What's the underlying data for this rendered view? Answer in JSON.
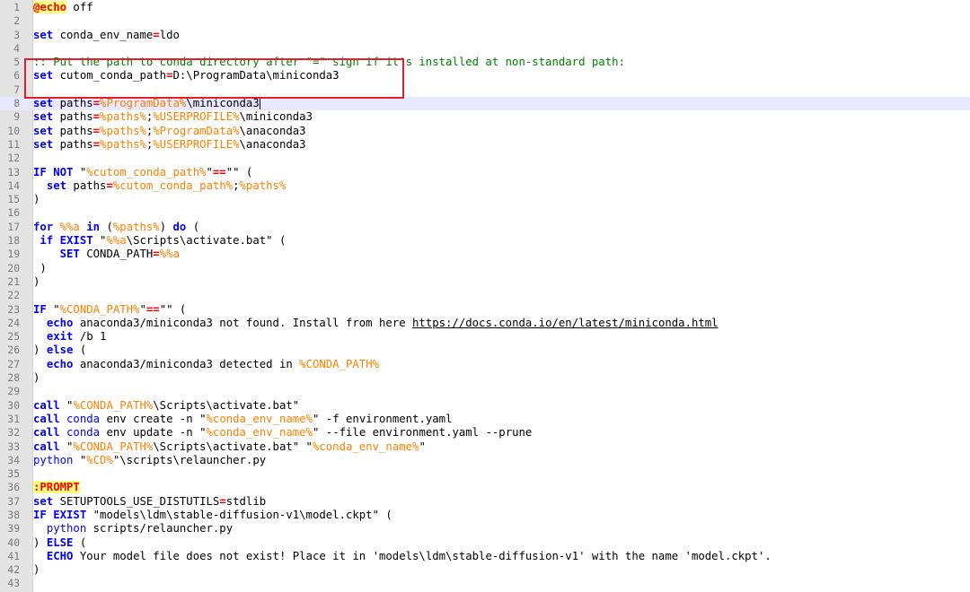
{
  "editor": {
    "lines": [
      {
        "n": "1",
        "tokens": [
          {
            "t": "@echo",
            "c": "lbl"
          },
          {
            "t": " off"
          }
        ]
      },
      {
        "n": "2",
        "tokens": []
      },
      {
        "n": "3",
        "tokens": [
          {
            "t": "set",
            "c": "k"
          },
          {
            "t": " conda_env_name"
          },
          {
            "t": "=",
            "c": "o"
          },
          {
            "t": "ldo"
          }
        ]
      },
      {
        "n": "4",
        "tokens": []
      },
      {
        "n": "5",
        "tokens": [
          {
            "t": ":: Put the path to conda directory after \"=\" sign if it's installed at non-standard path:",
            "c": "c"
          }
        ]
      },
      {
        "n": "6",
        "tokens": [
          {
            "t": "set",
            "c": "k"
          },
          {
            "t": " cutom_conda_path"
          },
          {
            "t": "=",
            "c": "o"
          },
          {
            "t": "D:\\ProgramData\\miniconda3"
          }
        ]
      },
      {
        "n": "7",
        "tokens": []
      },
      {
        "n": "8",
        "cur": true,
        "tokens": [
          {
            "t": "set",
            "c": "k"
          },
          {
            "t": " paths"
          },
          {
            "t": "=",
            "c": "o"
          },
          {
            "t": "%ProgramData%",
            "c": "v"
          },
          {
            "t": "\\miniconda3"
          },
          {
            "caret": true
          }
        ]
      },
      {
        "n": "9",
        "tokens": [
          {
            "t": "set",
            "c": "k"
          },
          {
            "t": " paths"
          },
          {
            "t": "=",
            "c": "o"
          },
          {
            "t": "%paths%",
            "c": "v"
          },
          {
            "t": ";"
          },
          {
            "t": "%USERPROFILE%",
            "c": "v"
          },
          {
            "t": "\\miniconda3"
          }
        ]
      },
      {
        "n": "10",
        "tokens": [
          {
            "t": "set",
            "c": "k"
          },
          {
            "t": " paths"
          },
          {
            "t": "=",
            "c": "o"
          },
          {
            "t": "%paths%",
            "c": "v"
          },
          {
            "t": ";"
          },
          {
            "t": "%ProgramData%",
            "c": "v"
          },
          {
            "t": "\\anaconda3"
          }
        ]
      },
      {
        "n": "11",
        "tokens": [
          {
            "t": "set",
            "c": "k"
          },
          {
            "t": " paths"
          },
          {
            "t": "=",
            "c": "o"
          },
          {
            "t": "%paths%",
            "c": "v"
          },
          {
            "t": ";"
          },
          {
            "t": "%USERPROFILE%",
            "c": "v"
          },
          {
            "t": "\\anaconda3"
          }
        ]
      },
      {
        "n": "12",
        "tokens": []
      },
      {
        "n": "13",
        "tokens": [
          {
            "t": "IF NOT",
            "c": "k"
          },
          {
            "t": " \""
          },
          {
            "t": "%cutom_conda_path%",
            "c": "v"
          },
          {
            "t": "\""
          },
          {
            "t": "==",
            "c": "o"
          },
          {
            "t": "\"\" ("
          }
        ]
      },
      {
        "n": "14",
        "tokens": [
          {
            "t": "  "
          },
          {
            "t": "set",
            "c": "k"
          },
          {
            "t": " paths"
          },
          {
            "t": "=",
            "c": "o"
          },
          {
            "t": "%cutom_conda_path%",
            "c": "v"
          },
          {
            "t": ";"
          },
          {
            "t": "%paths%",
            "c": "v"
          }
        ]
      },
      {
        "n": "15",
        "tokens": [
          {
            "t": ")"
          }
        ]
      },
      {
        "n": "16",
        "tokens": []
      },
      {
        "n": "17",
        "tokens": [
          {
            "t": "for",
            "c": "k"
          },
          {
            "t": " "
          },
          {
            "t": "%%a",
            "c": "v"
          },
          {
            "t": " "
          },
          {
            "t": "in",
            "c": "k"
          },
          {
            "t": " ("
          },
          {
            "t": "%paths%",
            "c": "v"
          },
          {
            "t": ") "
          },
          {
            "t": "do",
            "c": "k"
          },
          {
            "t": " ("
          }
        ]
      },
      {
        "n": "18",
        "tokens": [
          {
            "t": " "
          },
          {
            "t": "if EXIST",
            "c": "k"
          },
          {
            "t": " \""
          },
          {
            "t": "%%a",
            "c": "v"
          },
          {
            "t": "\\Scripts\\activate.bat\" ("
          }
        ]
      },
      {
        "n": "19",
        "tokens": [
          {
            "t": "    "
          },
          {
            "t": "SET",
            "c": "k"
          },
          {
            "t": " CONDA_PATH"
          },
          {
            "t": "=",
            "c": "o"
          },
          {
            "t": "%%a",
            "c": "v"
          }
        ]
      },
      {
        "n": "20",
        "tokens": [
          {
            "t": " )"
          }
        ]
      },
      {
        "n": "21",
        "tokens": [
          {
            "t": ")"
          }
        ]
      },
      {
        "n": "22",
        "tokens": []
      },
      {
        "n": "23",
        "tokens": [
          {
            "t": "IF",
            "c": "k"
          },
          {
            "t": " \""
          },
          {
            "t": "%CONDA_PATH%",
            "c": "v"
          },
          {
            "t": "\""
          },
          {
            "t": "==",
            "c": "o"
          },
          {
            "t": "\"\" ("
          }
        ]
      },
      {
        "n": "24",
        "tokens": [
          {
            "t": "  "
          },
          {
            "t": "echo",
            "c": "k"
          },
          {
            "t": " anaconda3/miniconda3 not found. Install from here "
          },
          {
            "t": "https://docs.conda.io/en/latest/miniconda.html",
            "c": "u"
          }
        ]
      },
      {
        "n": "25",
        "tokens": [
          {
            "t": "  "
          },
          {
            "t": "exit",
            "c": "k"
          },
          {
            "t": " /b 1"
          }
        ]
      },
      {
        "n": "26",
        "tokens": [
          {
            "t": ") "
          },
          {
            "t": "else",
            "c": "k"
          },
          {
            "t": " ("
          }
        ]
      },
      {
        "n": "27",
        "tokens": [
          {
            "t": "  "
          },
          {
            "t": "echo",
            "c": "k"
          },
          {
            "t": " anaconda3/miniconda3 detected in "
          },
          {
            "t": "%CONDA_PATH%",
            "c": "v"
          }
        ]
      },
      {
        "n": "28",
        "tokens": [
          {
            "t": ")"
          }
        ]
      },
      {
        "n": "29",
        "tokens": []
      },
      {
        "n": "30",
        "tokens": [
          {
            "t": "call",
            "c": "k"
          },
          {
            "t": " \""
          },
          {
            "t": "%CONDA_PATH%",
            "c": "v"
          },
          {
            "t": "\\Scripts\\activate.bat\""
          }
        ]
      },
      {
        "n": "31",
        "tokens": [
          {
            "t": "call",
            "c": "k"
          },
          {
            "t": " "
          },
          {
            "t": "conda",
            "c": "kn"
          },
          {
            "t": " env create -n \""
          },
          {
            "t": "%conda_env_name%",
            "c": "v"
          },
          {
            "t": "\" -f environment.yaml"
          }
        ]
      },
      {
        "n": "32",
        "tokens": [
          {
            "t": "call",
            "c": "k"
          },
          {
            "t": " "
          },
          {
            "t": "conda",
            "c": "kn"
          },
          {
            "t": " env update -n \""
          },
          {
            "t": "%conda_env_name%",
            "c": "v"
          },
          {
            "t": "\" --file environment.yaml --prune"
          }
        ]
      },
      {
        "n": "33",
        "tokens": [
          {
            "t": "call",
            "c": "k"
          },
          {
            "t": " \""
          },
          {
            "t": "%CONDA_PATH%",
            "c": "v"
          },
          {
            "t": "\\Scripts\\activate.bat\" \""
          },
          {
            "t": "%conda_env_name%",
            "c": "v"
          },
          {
            "t": "\""
          }
        ]
      },
      {
        "n": "34",
        "tokens": [
          {
            "t": "python",
            "c": "kn"
          },
          {
            "t": " \""
          },
          {
            "t": "%CD%",
            "c": "v"
          },
          {
            "t": "\"\\scripts\\relauncher.py"
          }
        ]
      },
      {
        "n": "35",
        "tokens": []
      },
      {
        "n": "36",
        "tokens": [
          {
            "t": ":PROMPT",
            "c": "lbl"
          }
        ]
      },
      {
        "n": "37",
        "tokens": [
          {
            "t": "set",
            "c": "k"
          },
          {
            "t": " SETUPTOOLS_USE_DISTUTILS"
          },
          {
            "t": "=",
            "c": "o"
          },
          {
            "t": "stdlib"
          }
        ]
      },
      {
        "n": "38",
        "tokens": [
          {
            "t": "IF EXIST",
            "c": "k"
          },
          {
            "t": " \"models\\ldm\\stable-diffusion-v1\\model.ckpt\" ("
          }
        ]
      },
      {
        "n": "39",
        "tokens": [
          {
            "t": "  "
          },
          {
            "t": "python",
            "c": "kn"
          },
          {
            "t": " scripts/relauncher.py"
          }
        ]
      },
      {
        "n": "40",
        "tokens": [
          {
            "t": ") "
          },
          {
            "t": "ELSE",
            "c": "k"
          },
          {
            "t": " ("
          }
        ]
      },
      {
        "n": "41",
        "tokens": [
          {
            "t": "  "
          },
          {
            "t": "ECHO",
            "c": "k"
          },
          {
            "t": " Your model file does not exist! Place it in 'models\\ldm\\stable-diffusion-v1' with the name 'model.ckpt'."
          }
        ]
      },
      {
        "n": "42",
        "tokens": [
          {
            "t": ")"
          }
        ]
      },
      {
        "n": "43",
        "tokens": []
      }
    ]
  }
}
